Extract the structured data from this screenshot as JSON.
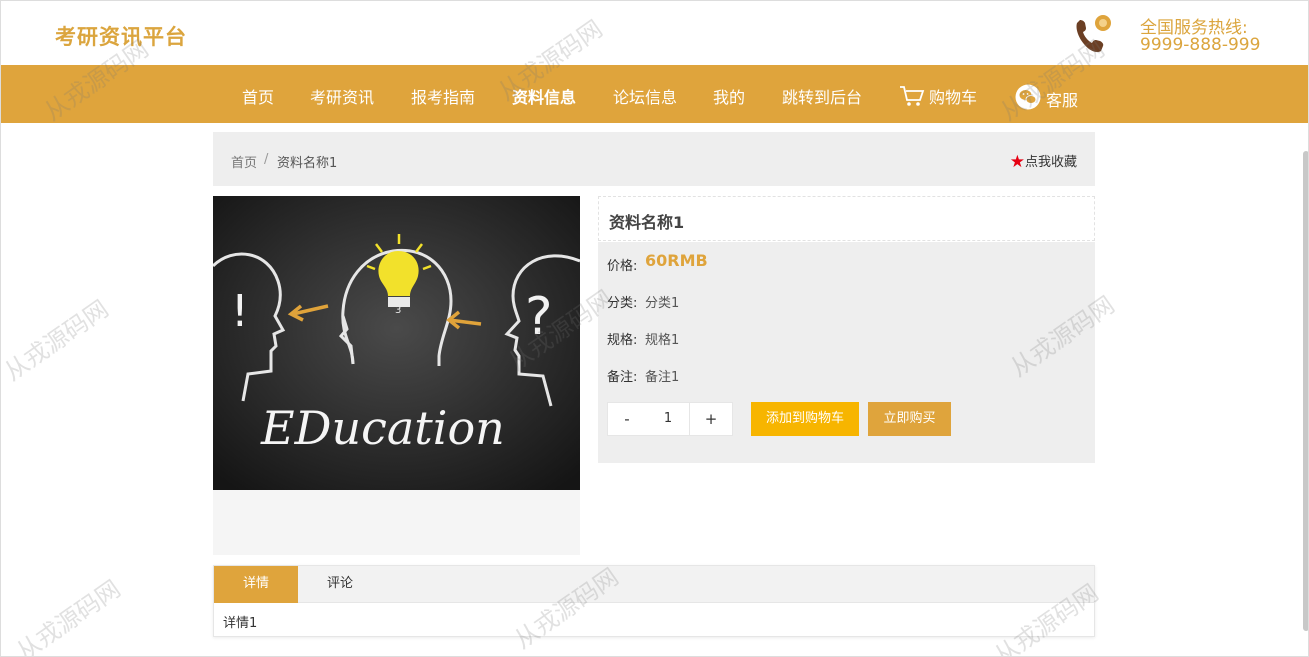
{
  "header": {
    "site_title": "考研资讯平台",
    "hotline_label": "全国服务热线:",
    "hotline_number": "9999-888-999"
  },
  "nav": {
    "items": [
      "首页",
      "考研资讯",
      "报考指南",
      "资料信息",
      "论坛信息",
      "我的",
      "跳转到后台",
      "购物车",
      "客服"
    ],
    "active_index": 3
  },
  "breadcrumb": {
    "home": "首页",
    "separator": "/",
    "current": "资料名称1"
  },
  "favorite": {
    "label": "点我收藏"
  },
  "product": {
    "image_text": "EDucation",
    "name": "资料名称1",
    "price_label": "价格:",
    "price": "60RMB",
    "category_label": "分类:",
    "category": "分类1",
    "spec_label": "规格:",
    "spec": "规格1",
    "remark_label": "备注:",
    "remark": "备注1",
    "quantity": "1",
    "minus": "-",
    "plus": "+",
    "add_to_cart": "添加到购物车",
    "buy_now": "立即购买"
  },
  "tabs": {
    "detail": "详情",
    "comment": "评论",
    "content": "详情1"
  },
  "watermark": "从戎源码网",
  "colors": {
    "primary": "#dfa43c",
    "cart_button": "#f7b500",
    "favorite_star": "#e60012"
  }
}
